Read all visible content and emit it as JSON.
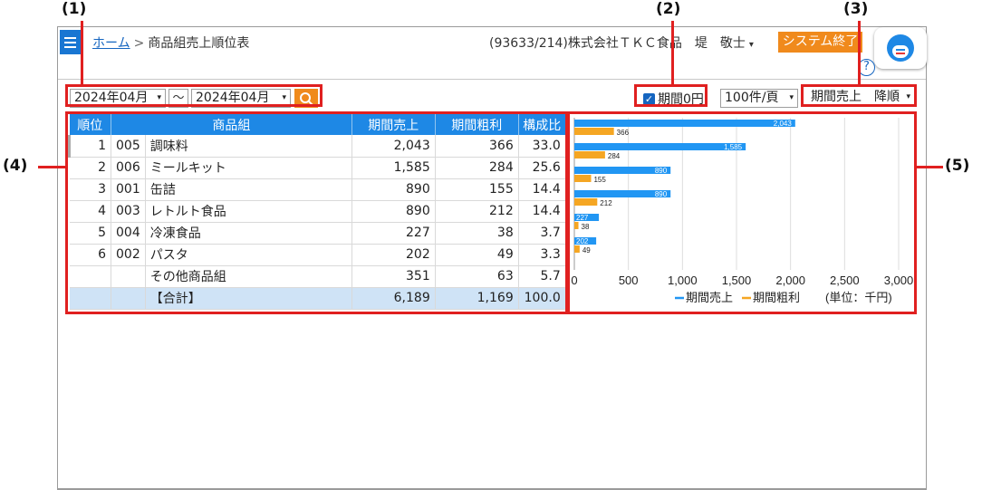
{
  "annotations": {
    "a1": "(1)",
    "a2": "(2)",
    "a3": "(3)",
    "a4": "(4)",
    "a5": "(5)"
  },
  "header": {
    "home_link": "ホーム",
    "breadcrumb_sep": ">",
    "page_title": "商品組売上順位表",
    "company_user": "(93633/214)株式会社ＴＫＣ食品　堤　敬士",
    "user_caret": "▾",
    "system_exit": "システム終了",
    "help": "?"
  },
  "filters": {
    "date_from": "2024年04月",
    "tilde": "〜",
    "date_to": "2024年04月",
    "zero_period_label": "期間0円",
    "zero_period_checked": true,
    "check_mark": "✓",
    "per_page": "100件/頁",
    "sort": "期間売上　降順",
    "caret": "▾"
  },
  "table": {
    "headers": [
      "順位",
      "商品組",
      "期間売上",
      "期間粗利",
      "構成比"
    ],
    "rows": [
      {
        "rank": "1",
        "code": "005",
        "name": "調味料",
        "sales": "2,043",
        "profit": "366",
        "ratio": "33.0"
      },
      {
        "rank": "2",
        "code": "006",
        "name": "ミールキット",
        "sales": "1,585",
        "profit": "284",
        "ratio": "25.6"
      },
      {
        "rank": "3",
        "code": "001",
        "name": "缶詰",
        "sales": "890",
        "profit": "155",
        "ratio": "14.4"
      },
      {
        "rank": "4",
        "code": "003",
        "name": "レトルト食品",
        "sales": "890",
        "profit": "212",
        "ratio": "14.4"
      },
      {
        "rank": "5",
        "code": "004",
        "name": "冷凍食品",
        "sales": "227",
        "profit": "38",
        "ratio": "3.7"
      },
      {
        "rank": "6",
        "code": "002",
        "name": "パスタ",
        "sales": "202",
        "profit": "49",
        "ratio": "3.3"
      },
      {
        "rank": "",
        "code": "",
        "name": "その他商品組",
        "sales": "351",
        "profit": "63",
        "ratio": "5.7"
      }
    ],
    "total": {
      "rank": "",
      "code": "",
      "name": "【合計】",
      "sales": "6,189",
      "profit": "1,169",
      "ratio": "100.0"
    }
  },
  "chart_data": {
    "type": "bar",
    "orientation": "horizontal",
    "categories": [
      "調味料",
      "ミールキット",
      "缶詰",
      "レトルト食品",
      "冷凍食品",
      "パスタ"
    ],
    "series": [
      {
        "name": "期間売上",
        "values": [
          2043,
          1585,
          890,
          890,
          227,
          202
        ],
        "color": "#2196f3"
      },
      {
        "name": "期間粗利",
        "values": [
          366,
          284,
          155,
          212,
          38,
          49
        ],
        "color": "#f5a623"
      }
    ],
    "xlim": [
      0,
      3000
    ],
    "xticks": [
      "0",
      "500",
      "1,000",
      "1,500",
      "2,000",
      "2,500",
      "3,000"
    ],
    "unit_label": "(単位：千円)",
    "legend_placement": "bottom-right",
    "grid": true
  }
}
